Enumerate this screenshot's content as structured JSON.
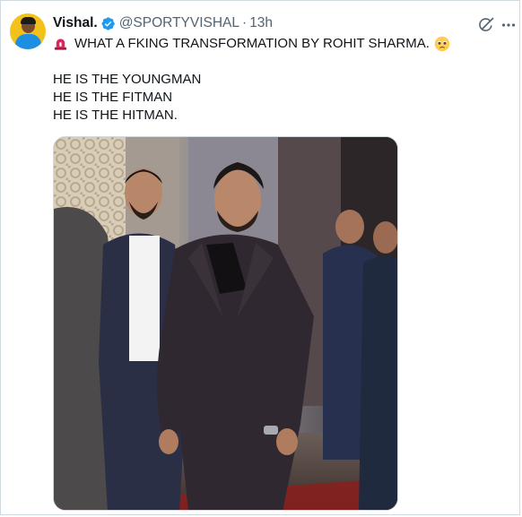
{
  "author": {
    "display_name": "Vishal.",
    "handle": "@SPORTYVISHAL",
    "separator": "·",
    "timestamp": "13h",
    "verified": true
  },
  "tweet": {
    "line1": "WHAT A FKING TRANSFORMATION BY ROHIT SHARMA.",
    "lines": [
      "HE IS THE YOUNGMAN",
      "HE IS THE FITMAN",
      "HE IS THE HITMAN."
    ],
    "emojis": [
      "siren-icon",
      "pleading-face-icon"
    ]
  },
  "colors": {
    "text": "#0f1419",
    "muted": "#536471",
    "verified_blue": "#1d9bf0",
    "avatar_bg": "#f2c21a",
    "siren_red": "#e0245e"
  },
  "media": {
    "type": "photo"
  }
}
